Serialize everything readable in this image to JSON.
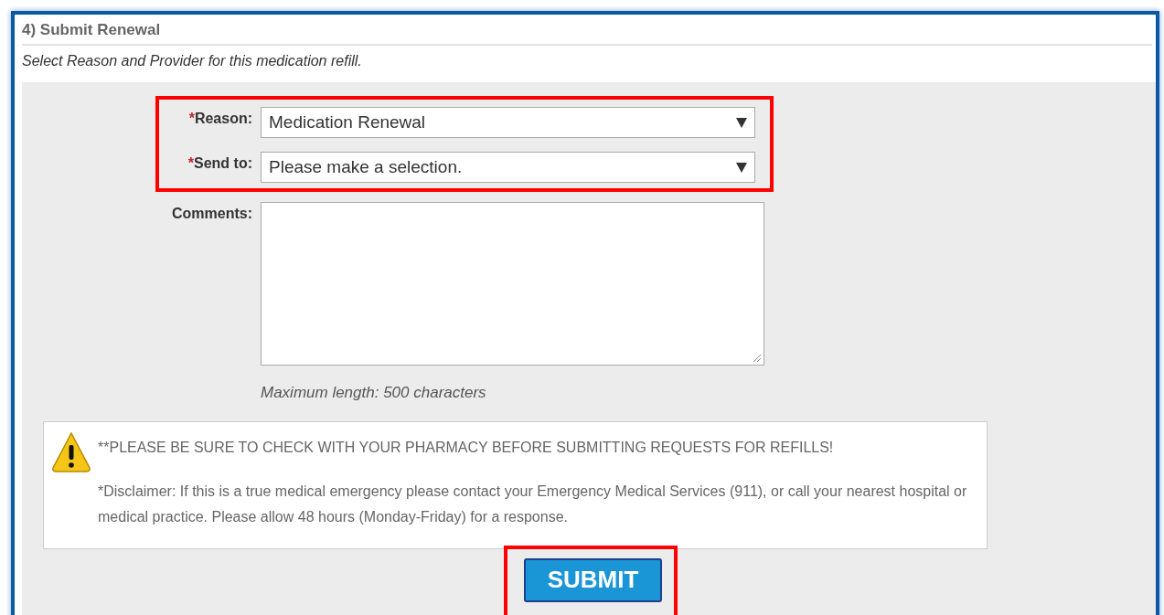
{
  "required_marker": "*",
  "section": {
    "title": "4) Submit Renewal",
    "instructions": "Select Reason and Provider for this medication refill."
  },
  "field_groups": [
    {
      "highlighted": true,
      "fields": [
        {
          "kind": "select",
          "label": "Reason:",
          "required": true,
          "value": "Medication Renewal"
        },
        {
          "kind": "select",
          "label": "Send to:",
          "required": true,
          "value": "Please make a selection."
        }
      ]
    },
    {
      "highlighted": false,
      "fields": [
        {
          "kind": "textarea",
          "label": "Comments:",
          "required": false,
          "hint": "Maximum length: 500 characters"
        }
      ]
    }
  ],
  "notice": {
    "heading": "**PLEASE BE SURE TO CHECK WITH YOUR PHARMACY BEFORE SUBMITTING REQUESTS FOR REFILLS!",
    "disclaimer": "*Disclaimer: If this is a true medical emergency please contact your Emergency Medical Services (911), or call your nearest hospital or medical practice. Please allow 48 hours (Monday-Friday) for a response."
  },
  "submit_button": {
    "label": "SUBMIT",
    "highlighted": true
  }
}
